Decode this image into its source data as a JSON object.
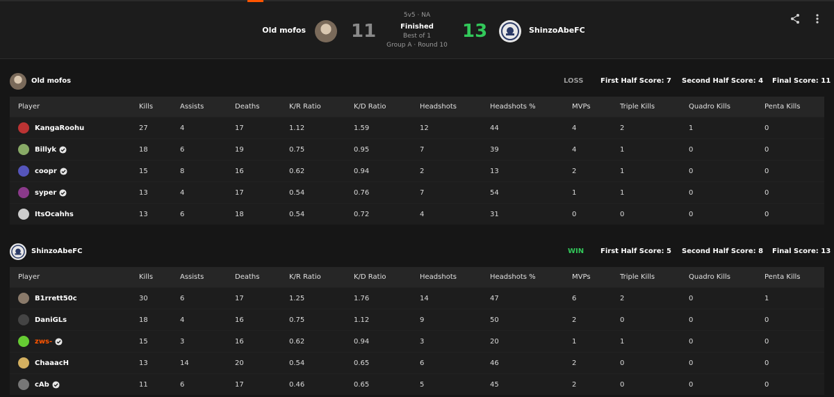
{
  "match": {
    "format": "5v5 · NA",
    "status": "Finished",
    "bestof": "Best of 1",
    "round": "Group A · Round 10",
    "team1": {
      "name": "Old mofos",
      "score": "11"
    },
    "team2": {
      "name": "ShinzoAbeFC",
      "score": "13"
    }
  },
  "header_icons": [
    "share-icon",
    "more-vertical-icon"
  ],
  "colors": {
    "win": "#32c85a",
    "loss": "#9a9a9a",
    "accent": "#ff5500"
  },
  "columns": [
    "Player",
    "Kills",
    "Assists",
    "Deaths",
    "K/R Ratio",
    "K/D Ratio",
    "Headshots",
    "Headshots %",
    "MVPs",
    "Triple Kills",
    "Quadro Kills",
    "Penta Kills"
  ],
  "teams": [
    {
      "name": "Old mofos",
      "result": "LOSS",
      "first_half": "First Half Score: 7",
      "second_half": "Second Half Score: 4",
      "final": "Final Score: 11",
      "players": [
        {
          "name": "KangaRoohu",
          "verified": false,
          "stats": [
            "27",
            "4",
            "17",
            "1.12",
            "1.59",
            "12",
            "44",
            "4",
            "2",
            "1",
            "0"
          ]
        },
        {
          "name": "Billyk",
          "verified": true,
          "stats": [
            "18",
            "6",
            "19",
            "0.75",
            "0.95",
            "7",
            "39",
            "4",
            "1",
            "0",
            "0"
          ]
        },
        {
          "name": "coopr",
          "verified": true,
          "stats": [
            "15",
            "8",
            "16",
            "0.62",
            "0.94",
            "2",
            "13",
            "2",
            "1",
            "0",
            "0"
          ]
        },
        {
          "name": "syper",
          "verified": true,
          "stats": [
            "13",
            "4",
            "17",
            "0.54",
            "0.76",
            "7",
            "54",
            "1",
            "1",
            "0",
            "0"
          ]
        },
        {
          "name": "ItsOcahhs",
          "verified": false,
          "stats": [
            "13",
            "6",
            "18",
            "0.54",
            "0.72",
            "4",
            "31",
            "0",
            "0",
            "0",
            "0"
          ]
        }
      ]
    },
    {
      "name": "ShinzoAbeFC",
      "result": "WIN",
      "first_half": "First Half Score: 5",
      "second_half": "Second Half Score: 8",
      "final": "Final Score: 13",
      "players": [
        {
          "name": "B1rrett50c",
          "verified": false,
          "stats": [
            "30",
            "6",
            "17",
            "1.25",
            "1.76",
            "14",
            "47",
            "6",
            "2",
            "0",
            "1"
          ]
        },
        {
          "name": "DaniGLs",
          "verified": false,
          "stats": [
            "18",
            "4",
            "16",
            "0.75",
            "1.12",
            "9",
            "50",
            "2",
            "0",
            "0",
            "0"
          ]
        },
        {
          "name": "zws-",
          "verified": true,
          "highlight": true,
          "stats": [
            "15",
            "3",
            "16",
            "0.62",
            "0.94",
            "3",
            "20",
            "1",
            "1",
            "0",
            "0"
          ]
        },
        {
          "name": "ChaaacH",
          "verified": false,
          "stats": [
            "13",
            "14",
            "20",
            "0.54",
            "0.65",
            "6",
            "46",
            "2",
            "0",
            "0",
            "0"
          ]
        },
        {
          "name": "cAb",
          "verified": true,
          "stats": [
            "11",
            "6",
            "17",
            "0.46",
            "0.65",
            "5",
            "45",
            "2",
            "0",
            "0",
            "0"
          ]
        }
      ]
    }
  ]
}
